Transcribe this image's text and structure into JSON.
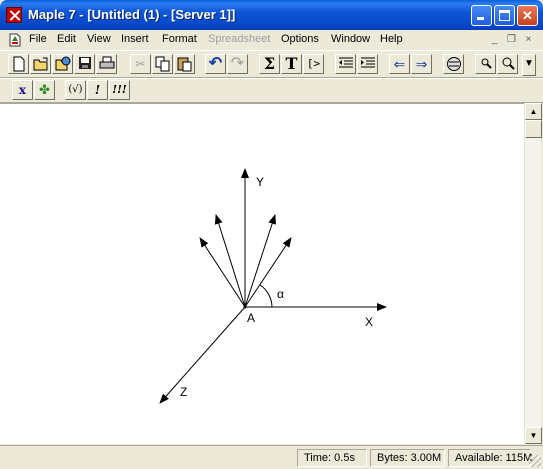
{
  "window": {
    "title": "Maple 7  - [Untitled (1) - [Server 1]]",
    "controls": [
      "minimize",
      "maximize",
      "close"
    ]
  },
  "menubar": {
    "items": [
      {
        "label": "File",
        "enabled": true
      },
      {
        "label": "Edit",
        "enabled": true
      },
      {
        "label": "View",
        "enabled": true
      },
      {
        "label": "Insert",
        "enabled": true
      },
      {
        "label": "Format",
        "enabled": true
      },
      {
        "label": "Spreadsheet",
        "enabled": false
      },
      {
        "label": "Options",
        "enabled": true
      },
      {
        "label": "Window",
        "enabled": true
      },
      {
        "label": "Help",
        "enabled": true
      }
    ],
    "mdi_controls": {
      "minimize": "_",
      "restore": "❐",
      "close": "×"
    }
  },
  "toolbar": {
    "buttons": [
      {
        "name": "new-icon",
        "glyph": "🗋"
      },
      {
        "name": "open-icon",
        "glyph": "📂"
      },
      {
        "name": "open-url-icon",
        "glyph": "🌐"
      },
      {
        "name": "save-icon",
        "glyph": "💾"
      },
      {
        "name": "print-icon",
        "glyph": "🖶"
      },
      {
        "name": "cut-icon",
        "glyph": "✂",
        "disabled": true
      },
      {
        "name": "copy-icon",
        "glyph": "⧉"
      },
      {
        "name": "paste-icon",
        "glyph": "📋"
      },
      {
        "name": "undo-icon",
        "glyph": "↶"
      },
      {
        "name": "redo-icon",
        "glyph": "↷",
        "disabled": true
      },
      {
        "name": "sigma-icon",
        "glyph": "Σ"
      },
      {
        "name": "text-icon",
        "glyph": "T"
      },
      {
        "name": "prompt-icon",
        "glyph": "[>"
      },
      {
        "name": "outdent-icon",
        "glyph": "⇤"
      },
      {
        "name": "indent-icon",
        "glyph": "⇥"
      },
      {
        "name": "back-icon",
        "glyph": "⇐"
      },
      {
        "name": "forward-icon",
        "glyph": "⇒"
      },
      {
        "name": "stop-icon",
        "glyph": "⊜"
      },
      {
        "name": "zoom-in-icon",
        "glyph": "🔍"
      },
      {
        "name": "zoom-out-icon",
        "glyph": "🔎"
      },
      {
        "name": "toolbar-dropdown-icon",
        "glyph": "▾"
      }
    ]
  },
  "toolbar2": {
    "buttons": [
      {
        "name": "math-mode-icon",
        "glyph": "x"
      },
      {
        "name": "maple-leaf-icon",
        "glyph": "✤"
      },
      {
        "name": "check-expr-icon",
        "glyph": "(√)"
      },
      {
        "name": "execute-icon",
        "glyph": "!"
      },
      {
        "name": "execute-all-icon",
        "glyph": "!!!"
      }
    ]
  },
  "diagram": {
    "labels": {
      "y": "Y",
      "x": "X",
      "z": "Z",
      "origin": "A",
      "angle": "α"
    }
  },
  "statusbar": {
    "time": "Time:   0.5s",
    "bytes": "Bytes: 3.00M",
    "available": "Available: 115M"
  },
  "colors": {
    "titlebar": "#0a5fd8",
    "chrome": "#ece9d8",
    "doc_background": "#ffffff"
  }
}
